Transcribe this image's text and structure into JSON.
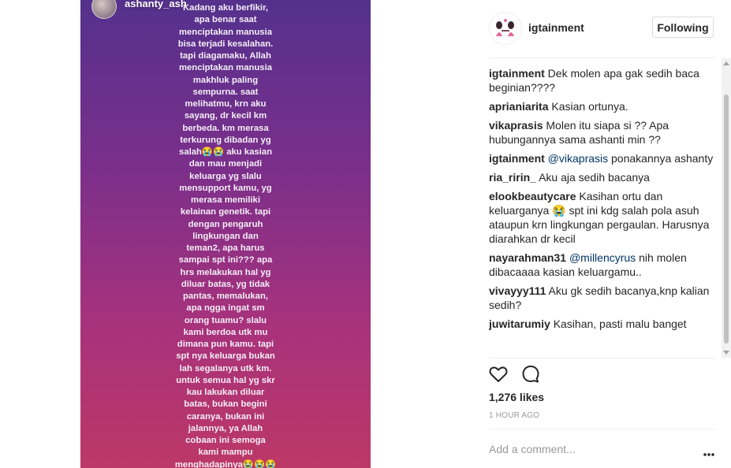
{
  "story": {
    "username": "ashanty_ash",
    "text": "Kadang aku berfikir,\napa benar saat\nmenciptakan manusia\nbisa terjadi kesalahan.\ntapi diagamaku, Allah\nmenciptakan manusia\nmakhluk paling\nsempurna. saat\nmelihatmu, krn aku\nsayang, dr kecil km\nberbeda. km merasa\nterkurung dibadan yg\nsalah😭😭 aku kasian\ndan mau menjadi\nkeluarga yg slalu\nmensupport kamu, yg\nmerasa memiliki\nkelainan genetik. tapi\ndengan pengaruh\nlingkungan dan\nteman2, apa harus\nsampai spt ini??? apa\nhrs melakukan hal yg\ndiluar batas, yg tidak\npantas, memalukan,\napa ngga ingat sm\norang tuamu? slalu\nkami berdoa utk mu\ndimana pun kamu. tapi\nspt nya keluarga bukan\nlah segalanya utk km.\nuntuk semua hal yg skr\nkau lakukan diluar\nbatas, bukan begini\ncaranya, bukan ini\njalannya, ya Allah\ncobaan ini semoga\nkami mampu\nmenghadapinya😭😭😭"
  },
  "header": {
    "username": "igtainment",
    "follow_label": "Following"
  },
  "comments": [
    {
      "user": "igtainment",
      "pre": "Dek molen apa gak sedih baca beginian????",
      "mention": "",
      "post": ""
    },
    {
      "user": "aprianiarita",
      "pre": "Kasian ortunya.",
      "mention": "",
      "post": ""
    },
    {
      "user": "vikaprasis",
      "pre": "Molen itu siapa si ?? Apa hubungannya sama ashanti min ??",
      "mention": "",
      "post": ""
    },
    {
      "user": "igtainment",
      "pre": "",
      "mention": "@vikaprasis",
      "post": " ponakannya ashanty"
    },
    {
      "user": "ria_ririn_",
      "pre": "Aku aja sedih bacanya",
      "mention": "",
      "post": ""
    },
    {
      "user": "elookbeautycare",
      "pre": "Kasihan ortu dan keluarganya 😭 spt ini kdg salah pola asuh ataupun krn lingkungan pergaulan. Harusnya diarahkan dr kecil",
      "mention": "",
      "post": ""
    },
    {
      "user": "nayarahman31",
      "pre": "",
      "mention": "@millencyrus",
      "post": " nih molen dibacaaaa kasian keluargamu.."
    },
    {
      "user": "vivayyy111",
      "pre": "Aku gk sedih bacanya,knp kalian sedih?",
      "mention": "",
      "post": ""
    },
    {
      "user": "juwitarumiy",
      "pre": "Kasihan, pasti malu banget",
      "mention": "",
      "post": ""
    }
  ],
  "actions": {
    "likes": "1,276 likes",
    "time": "1 hour ago",
    "comment_placeholder": "Add a comment..."
  },
  "icons": {
    "like": "heart-icon",
    "comment": "comment-icon",
    "more": "more-options-icon"
  }
}
